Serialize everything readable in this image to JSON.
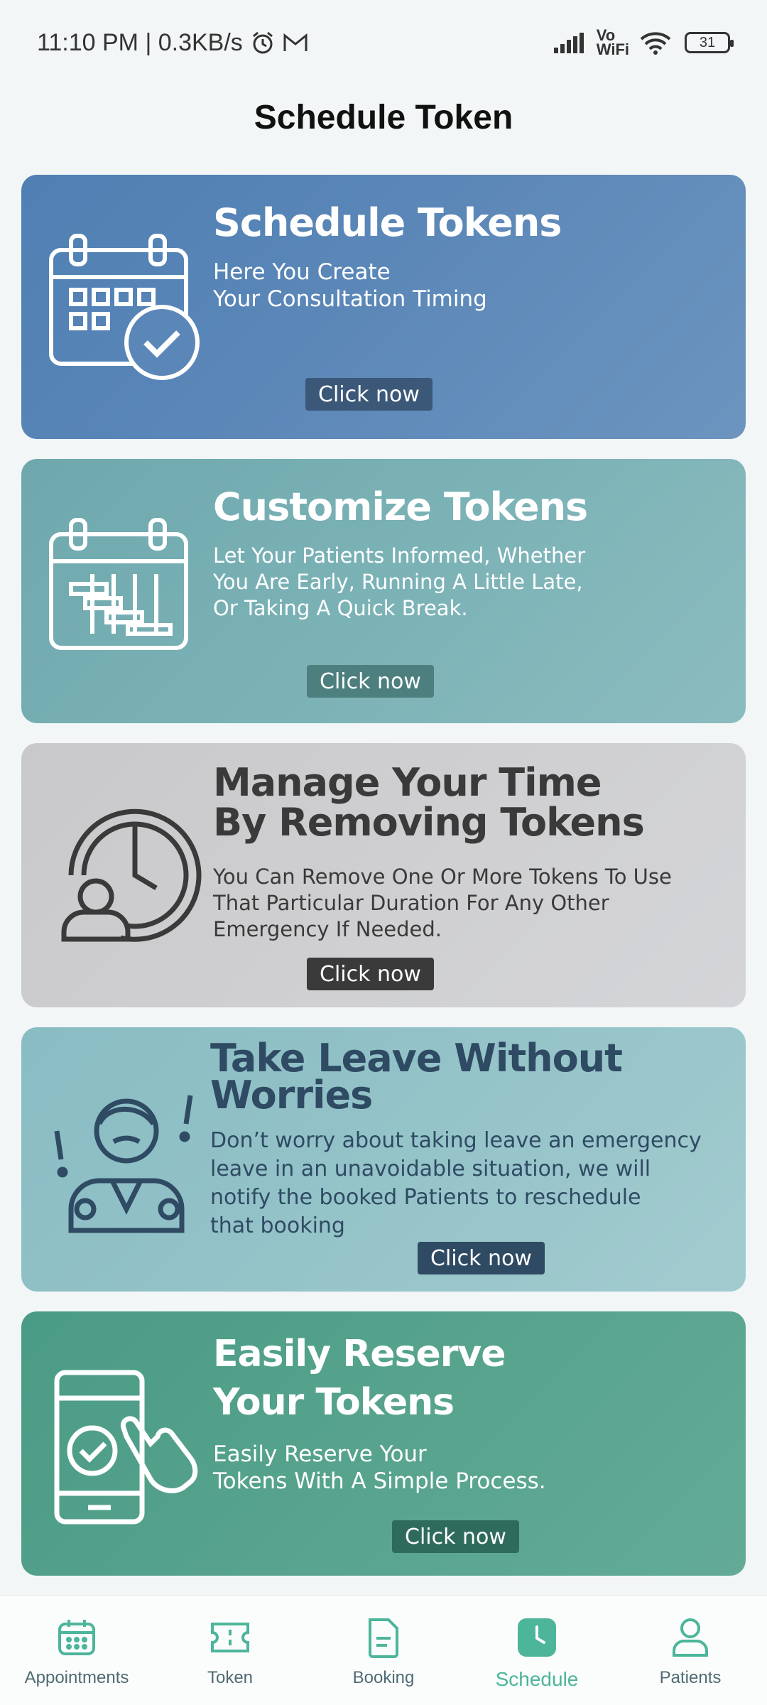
{
  "status_bar": {
    "time_speed": "11:10 PM | 0.3KB/s",
    "network_label_top": "Vo",
    "network_label_bottom": "WiFi",
    "battery": "31"
  },
  "page": {
    "title": "Schedule Token"
  },
  "cards": [
    {
      "title": "Schedule Tokens",
      "description_lines": [
        "Here You  Create",
        "Your Consultation Timing"
      ],
      "cta": "Click now",
      "icon": "calendar-check-icon"
    },
    {
      "title": "Customize Tokens",
      "description_lines": [
        "Let Your Patients Informed, Whether",
        "You Are Early, Running A Little Late,",
        "Or Taking A Quick Break."
      ],
      "cta": "Click now",
      "icon": "calendar-gantt-icon"
    },
    {
      "title_lines": [
        "Manage Your Time",
        "By Removing Tokens"
      ],
      "description_lines": [
        "You Can Remove One Or More Tokens To Use",
        "That Particular Duration For Any Other",
        "Emergency If Needed."
      ],
      "cta": "Click now",
      "icon": "clock-user-icon"
    },
    {
      "title_lines": [
        "Take Leave Without",
        "Worries"
      ],
      "description_lines": [
        "Don’t worry about taking leave an emergency",
        "leave in an unavoidable situation, we will",
        "notify the booked Patients to reschedule",
        "that booking"
      ],
      "cta": "Click now",
      "icon": "worried-doctor-icon"
    },
    {
      "title_lines": [
        "Easily Reserve",
        "Your Tokens"
      ],
      "description_lines": [
        "Easily Reserve Your",
        "Tokens With A Simple Process."
      ],
      "cta": "Click now",
      "icon": "phone-tap-icon"
    }
  ],
  "bottom_nav": [
    {
      "label": "Appointments",
      "icon": "calendar-icon"
    },
    {
      "label": "Token",
      "icon": "ticket-icon"
    },
    {
      "label": "Booking",
      "icon": "document-icon"
    },
    {
      "label": "Schedule",
      "icon": "clock-icon",
      "active": true
    },
    {
      "label": "Patients",
      "icon": "user-icon"
    }
  ],
  "colors": {
    "accent": "#4cb59a",
    "nav_text": "#4f6b73"
  }
}
